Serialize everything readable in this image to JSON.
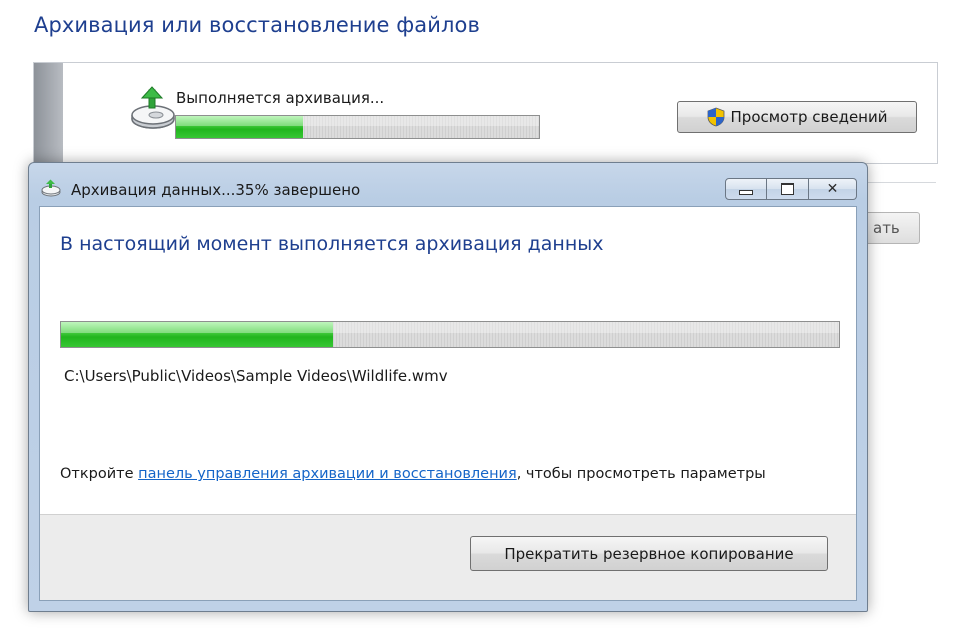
{
  "page": {
    "title": "Архивация или восстановление файлов"
  },
  "background_panel": {
    "status_text": "Выполняется архивация...",
    "progress": 0.35,
    "details_button_label": "Просмотр сведений",
    "partial_button_label": "ать",
    "icon": "backup-drive-icon"
  },
  "dialog": {
    "title": "Архивация данных...35% завершено",
    "heading": "В настоящий момент выполняется архивация данных",
    "progress": 0.35,
    "file_path": "C:\\Users\\Public\\Videos\\Sample Videos\\Wildlife.wmv",
    "info_prefix": "Откройте ",
    "info_link": "панель управления архивации и восстановления",
    "info_suffix": ", чтобы просмотреть параметры",
    "stop_button_label": "Прекратить резервное копирование",
    "titlebar_buttons": {
      "minimize": "minimize-icon",
      "maximize": "maximize-icon",
      "close": "close-icon"
    }
  },
  "colors": {
    "title_blue": "#1e3f8f",
    "link_blue": "#1565c8",
    "progress_green": "#21b51d"
  }
}
